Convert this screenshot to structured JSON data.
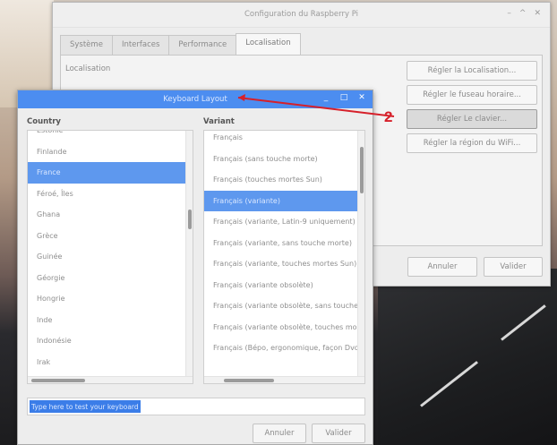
{
  "config_window": {
    "title": "Configuration du Raspberry Pi",
    "controls": [
      "–",
      "^",
      "✕"
    ],
    "tabs": [
      {
        "label": "Système"
      },
      {
        "label": "Interfaces"
      },
      {
        "label": "Performance"
      },
      {
        "label": "Localisation",
        "active": true
      }
    ],
    "panel_label": "Localisation",
    "buttons": [
      {
        "label": "Régler la Localisation..."
      },
      {
        "label": "Régler le fuseau horaire..."
      },
      {
        "label": "Régler Le clavier...",
        "pressed": true
      },
      {
        "label": "Régler la région du WiFi..."
      }
    ],
    "cancel_label": "Annuler",
    "validate_label": "Valider"
  },
  "keyboard_dialog": {
    "title": "Keyboard Layout",
    "controls": [
      "_",
      "□",
      "✕"
    ],
    "country_header": "Country",
    "variant_header": "Variant",
    "countries": [
      {
        "label": "Estonie"
      },
      {
        "label": "Finlande"
      },
      {
        "label": "France",
        "selected": true
      },
      {
        "label": "Féroé, Îles"
      },
      {
        "label": "Ghana"
      },
      {
        "label": "Grèce"
      },
      {
        "label": "Guinée"
      },
      {
        "label": "Géorgie"
      },
      {
        "label": "Hongrie"
      },
      {
        "label": "Inde"
      },
      {
        "label": "Indonésie"
      },
      {
        "label": "Irak"
      }
    ],
    "variants": [
      {
        "label": "Français"
      },
      {
        "label": "Français (sans touche morte)"
      },
      {
        "label": "Français (touches mortes Sun)"
      },
      {
        "label": "Français (variante)",
        "selected": true
      },
      {
        "label": "Français (variante, Latin-9 uniquement)"
      },
      {
        "label": "Français (variante, sans touche morte)"
      },
      {
        "label": "Français (variante, touches mortes Sun)"
      },
      {
        "label": "Français (variante obsolète)"
      },
      {
        "label": "Français (variante obsolète, sans touche morte)"
      },
      {
        "label": "Français (variante obsolète, touches mortes Sun)"
      },
      {
        "label": "Français (Bépo, ergonomique, façon Dvorak)"
      }
    ],
    "test_field_value": "Type here to test your keyboard",
    "cancel_label": "Annuler",
    "validate_label": "Valider"
  },
  "annotation": {
    "step_number": "2",
    "color": "#d6202a"
  },
  "colors": {
    "selection": "#5e98ee",
    "titlebar_active": "#4c8df0"
  }
}
